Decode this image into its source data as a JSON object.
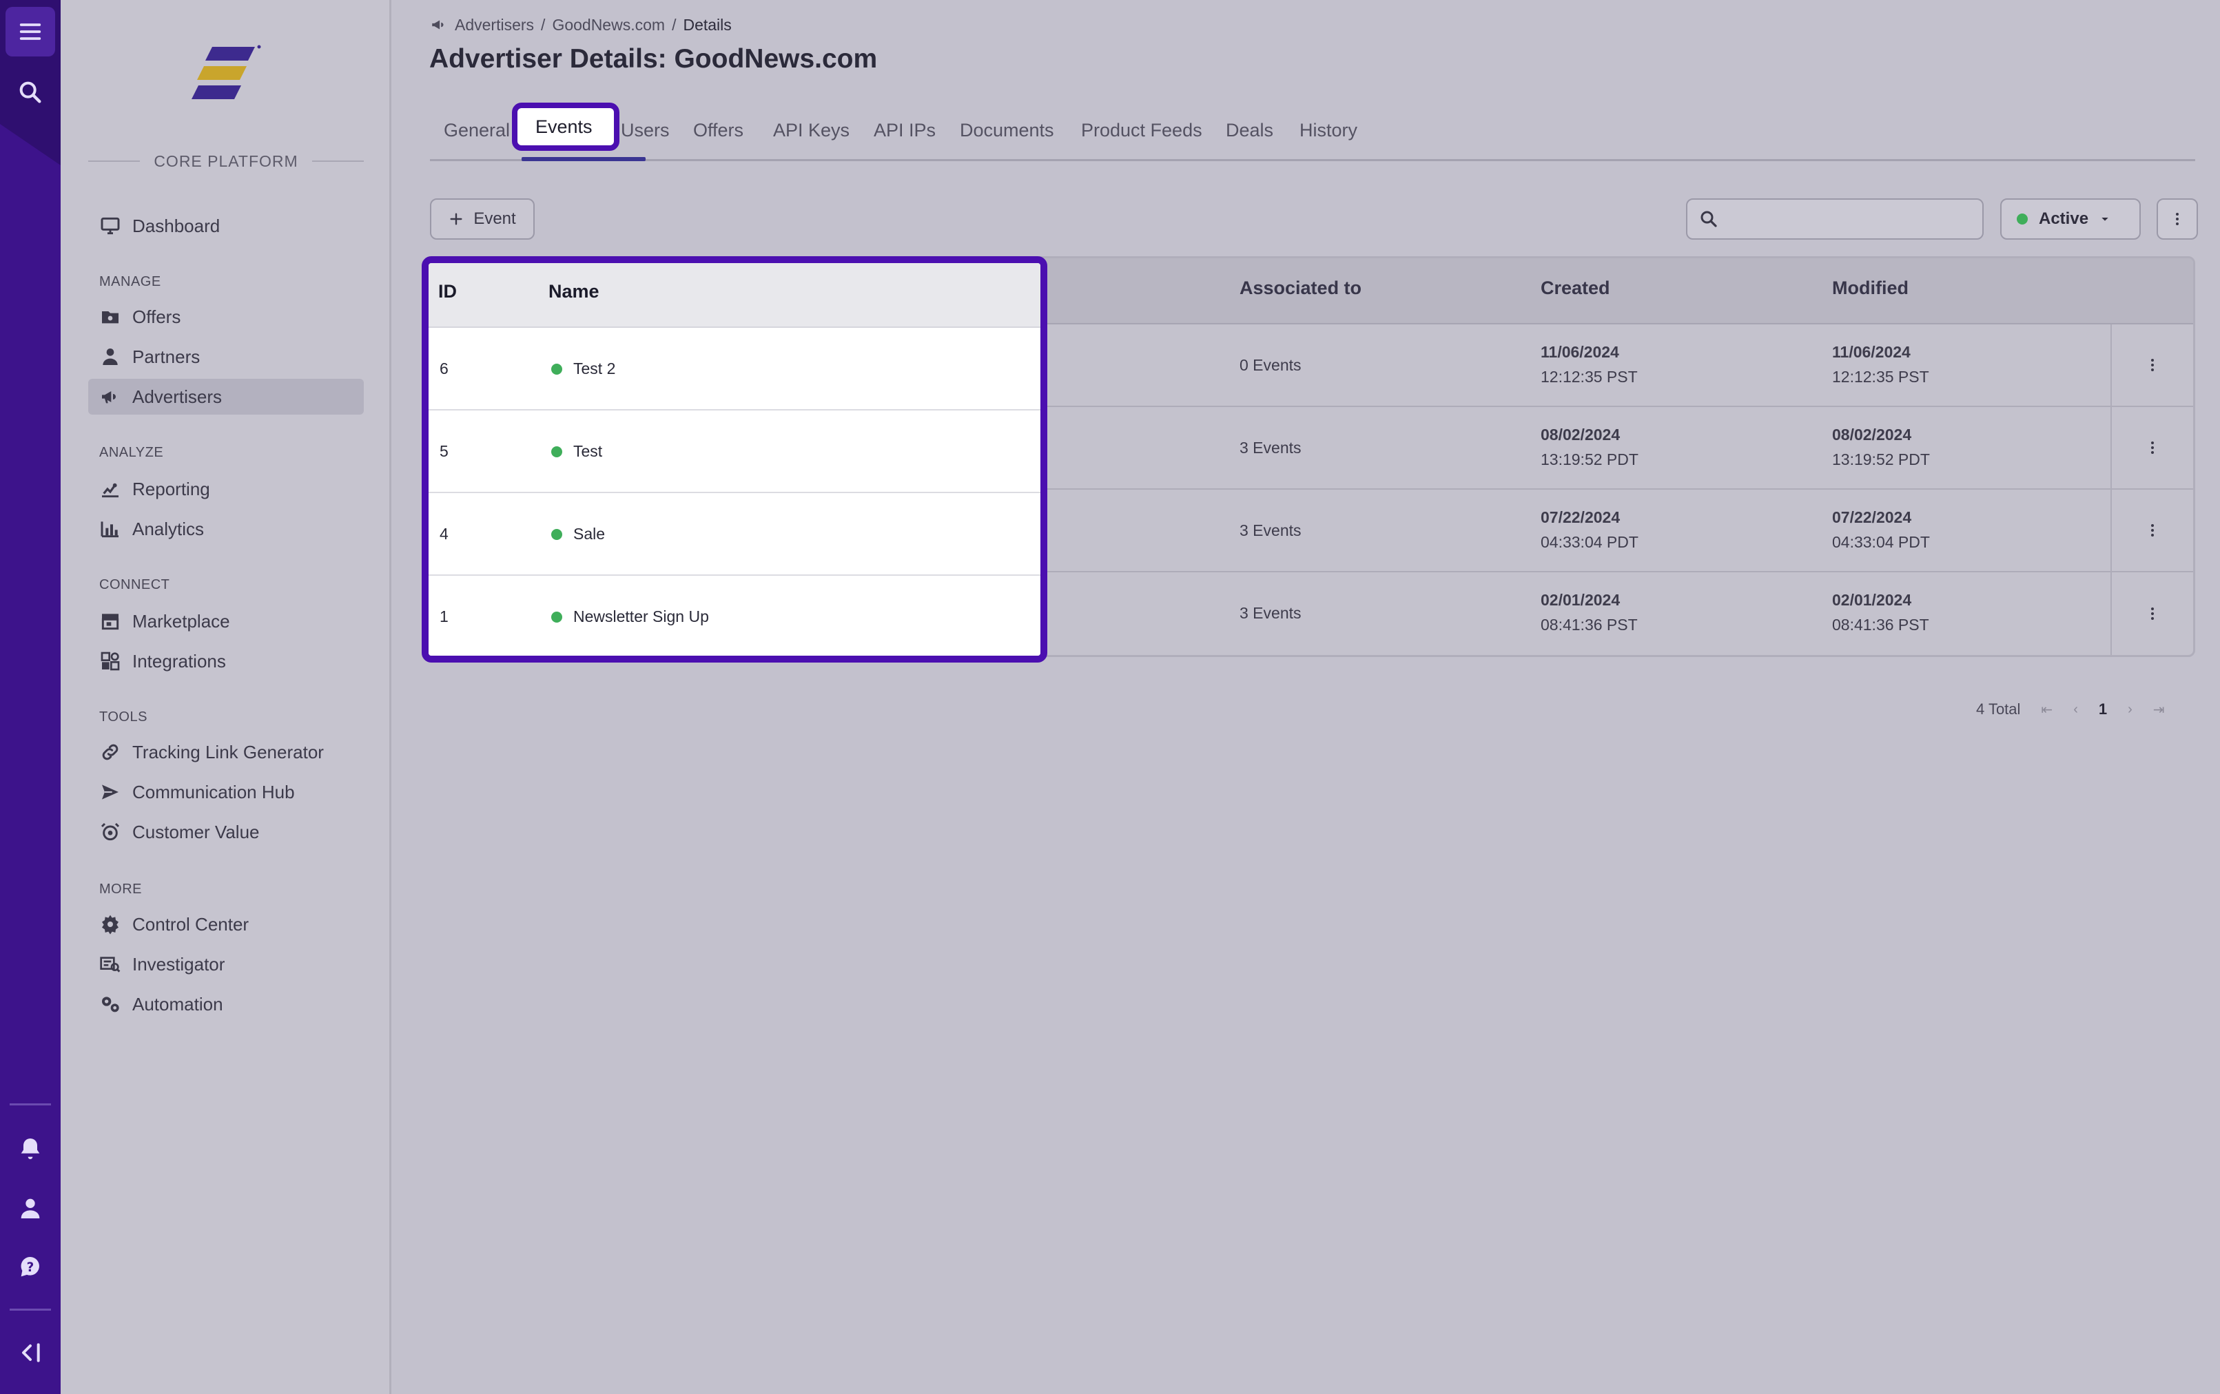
{
  "app": {
    "platform_label": "CORE PLATFORM"
  },
  "sidebar": {
    "sections": [
      {
        "title": ""
      },
      {
        "title": "MANAGE"
      },
      {
        "title": "ANALYZE"
      },
      {
        "title": "CONNECT"
      },
      {
        "title": "TOOLS"
      },
      {
        "title": "MORE"
      }
    ],
    "items": [
      {
        "label": "Dashboard",
        "icon": "monitor-icon"
      },
      {
        "label": "Offers",
        "icon": "folder-icon"
      },
      {
        "label": "Partners",
        "icon": "partner-icon"
      },
      {
        "label": "Advertisers",
        "icon": "megaphone-icon",
        "active": true
      },
      {
        "label": "Reporting",
        "icon": "reporting-icon"
      },
      {
        "label": "Analytics",
        "icon": "analytics-icon"
      },
      {
        "label": "Marketplace",
        "icon": "store-icon"
      },
      {
        "label": "Integrations",
        "icon": "integrations-icon"
      },
      {
        "label": "Tracking Link Generator",
        "icon": "link-icon"
      },
      {
        "label": "Communication Hub",
        "icon": "send-icon"
      },
      {
        "label": "Customer Value",
        "icon": "customer-value-icon"
      },
      {
        "label": "Control Center",
        "icon": "gear-icon"
      },
      {
        "label": "Investigator",
        "icon": "investigator-icon"
      },
      {
        "label": "Automation",
        "icon": "automation-icon"
      }
    ]
  },
  "breadcrumb": {
    "items": [
      "Advertisers",
      "GoodNews.com",
      "Details"
    ],
    "separator": "/"
  },
  "page": {
    "title": "Advertiser Details: GoodNews.com"
  },
  "tabs": [
    {
      "label": "General"
    },
    {
      "label": "Events",
      "active": true
    },
    {
      "label": "Users"
    },
    {
      "label": "Offers"
    },
    {
      "label": "API Keys"
    },
    {
      "label": "API IPs"
    },
    {
      "label": "Documents"
    },
    {
      "label": "Product Feeds"
    },
    {
      "label": "Deals"
    },
    {
      "label": "History"
    }
  ],
  "toolbar": {
    "add_label": "Event",
    "search_placeholder": "",
    "status_filter": "Active"
  },
  "table": {
    "columns": [
      "ID",
      "Name",
      "Associated to",
      "Created",
      "Modified"
    ],
    "rows": [
      {
        "id": "6",
        "name": "Test 2",
        "associated": "0 Events",
        "created_date": "11/06/2024",
        "created_time": "12:12:35 PST",
        "modified_date": "11/06/2024",
        "modified_time": "12:12:35 PST"
      },
      {
        "id": "5",
        "name": "Test",
        "associated": "3 Events",
        "created_date": "08/02/2024",
        "created_time": "13:19:52 PDT",
        "modified_date": "08/02/2024",
        "modified_time": "13:19:52 PDT"
      },
      {
        "id": "4",
        "name": "Sale",
        "associated": "3 Events",
        "created_date": "07/22/2024",
        "created_time": "04:33:04 PDT",
        "modified_date": "07/22/2024",
        "modified_time": "04:33:04 PDT"
      },
      {
        "id": "1",
        "name": "Newsletter Sign Up",
        "associated": "3 Events",
        "created_date": "02/01/2024",
        "created_time": "08:41:36 PST",
        "modified_date": "02/01/2024",
        "modified_time": "08:41:36 PST"
      }
    ]
  },
  "pagination": {
    "total": "4 Total",
    "current_page": "1"
  },
  "colors": {
    "rail": "#3d138b",
    "highlight": "#4b0fb0",
    "active_dot": "#3fae5a",
    "link": "#2d5cb0"
  }
}
